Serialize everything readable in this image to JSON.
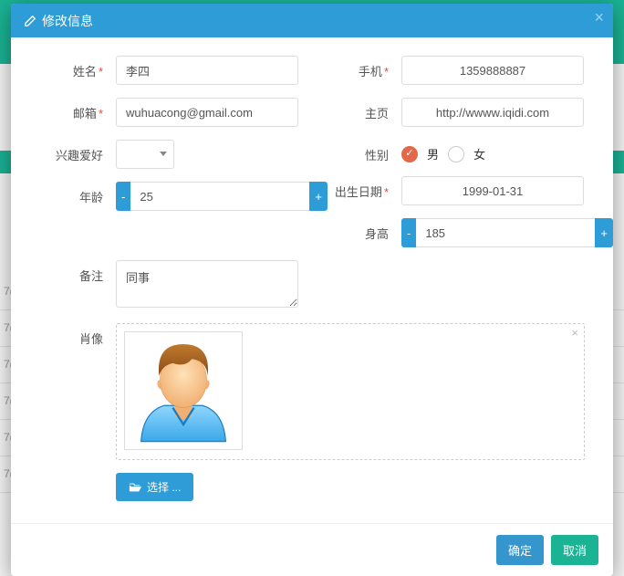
{
  "modal": {
    "title": "修改信息",
    "close_title": "关闭"
  },
  "labels": {
    "name": "姓名",
    "email": "邮箱",
    "hobby": "兴趣爱好",
    "age": "年龄",
    "phone": "手机",
    "homepage": "主页",
    "gender": "性别",
    "birthdate": "出生日期",
    "height": "身高",
    "remark": "备注",
    "portrait": "肖像"
  },
  "values": {
    "name": "李四",
    "email": "wuhuacong@gmail.com",
    "hobby": "",
    "age": "25",
    "phone": "1359888887",
    "homepage": "http://wwww.iqidi.com",
    "gender_male": "男",
    "gender_female": "女",
    "gender_selected": "male",
    "birthdate": "1999-01-31",
    "height": "185",
    "remark": "同事"
  },
  "buttons": {
    "minus": "-",
    "plus": "+",
    "select_file": "选择 ...",
    "ok": "确定",
    "cancel": "取消"
  },
  "colors": {
    "header": "#2e9cd6",
    "ok": "#3596cd",
    "cancel": "#1ab394",
    "radio_checked": "#e26847"
  }
}
